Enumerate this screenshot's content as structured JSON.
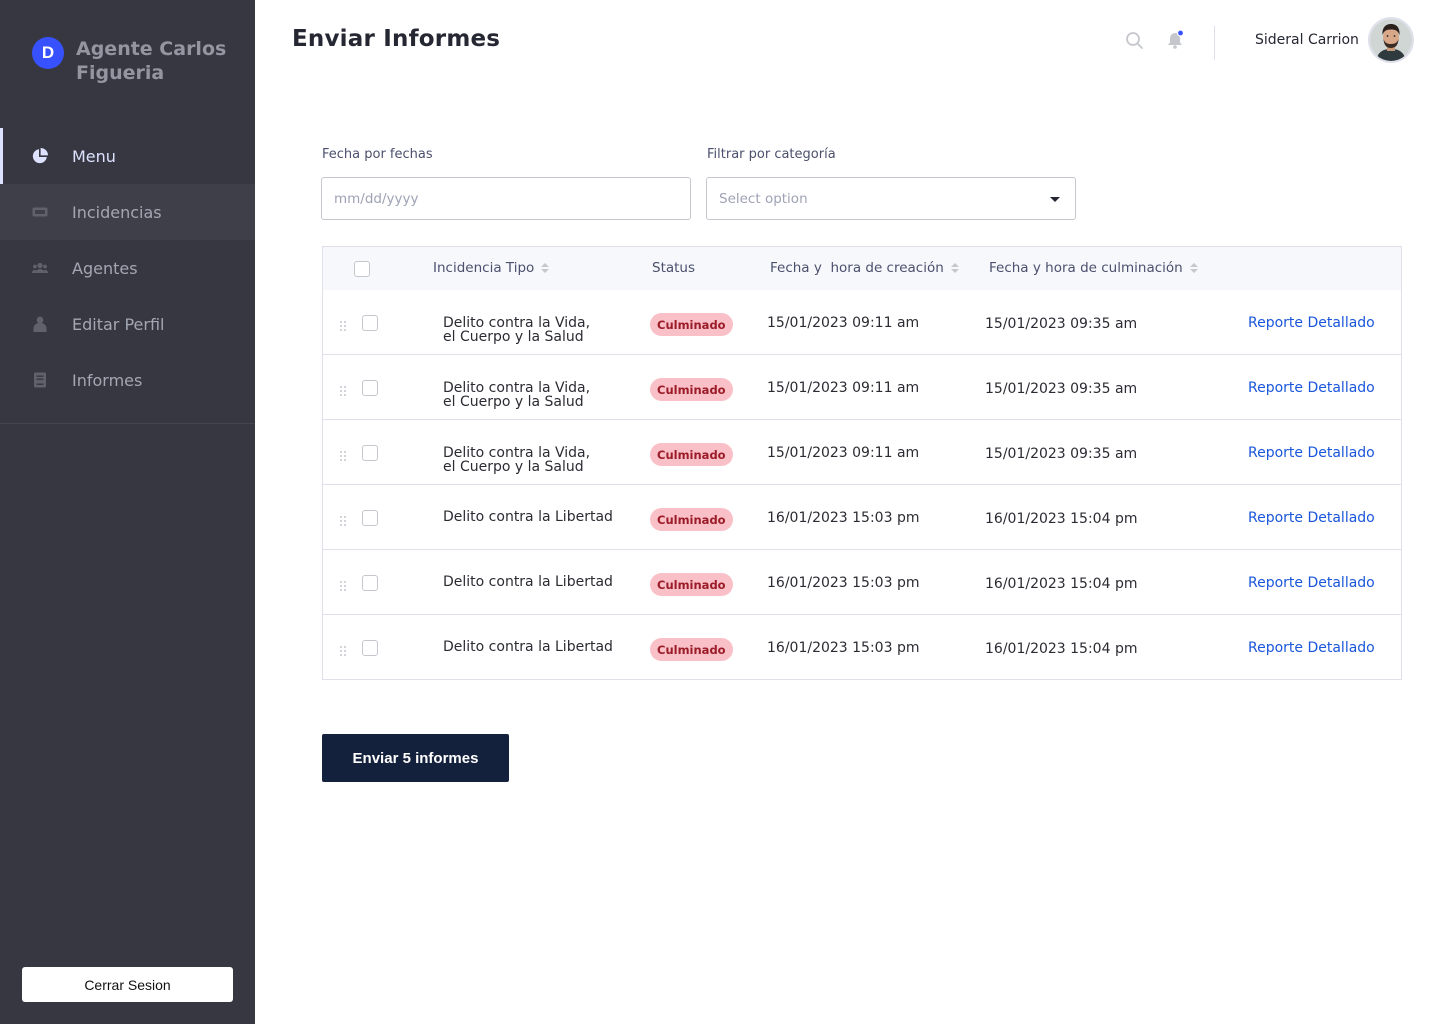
{
  "brand": {
    "logo_letter": "D",
    "name": "Agente Carlos Figueria"
  },
  "sidebar": {
    "items": [
      {
        "label": "Menu",
        "icon": "pie-chart-icon",
        "state": "active"
      },
      {
        "label": "Incidencias",
        "icon": "ticket-icon",
        "state": "hover"
      },
      {
        "label": "Agentes",
        "icon": "users-icon",
        "state": "normal"
      },
      {
        "label": "Editar Perfil",
        "icon": "user-icon",
        "state": "normal"
      },
      {
        "label": "Informes",
        "icon": "book-icon",
        "state": "normal"
      }
    ],
    "logout_label": "Cerrar Sesion"
  },
  "header": {
    "title": "Enviar Informes",
    "user_name": "Sideral Carrion",
    "search_icon": "search-icon",
    "bell_icon": "bell-icon"
  },
  "filters": {
    "date_label": "Fecha por fechas",
    "date_placeholder": "mm/dd/yyyy",
    "category_label": "Filtrar por categoría",
    "category_placeholder": "Select option"
  },
  "table": {
    "columns": {
      "type": "Incidencia Tipo",
      "status": "Status",
      "created": "Fecha y  hora de creación",
      "finished": "Fecha y hora de culminación"
    },
    "rows": [
      {
        "type_line1": "Delito contra la Vida,",
        "type_line2": "el Cuerpo y la Salud",
        "status": "Culminado",
        "created": "15/01/2023 09:11 am",
        "finished": "15/01/2023 09:35 am",
        "action": "Reporte Detallado"
      },
      {
        "type_line1": "Delito contra la Vida,",
        "type_line2": "el Cuerpo y la Salud",
        "status": "Culminado",
        "created": "15/01/2023 09:11 am",
        "finished": "15/01/2023 09:35 am",
        "action": "Reporte Detallado"
      },
      {
        "type_line1": "Delito contra la Vida,",
        "type_line2": "el Cuerpo y la Salud",
        "status": "Culminado",
        "created": "15/01/2023 09:11 am",
        "finished": "15/01/2023 09:35 am",
        "action": "Reporte Detallado"
      },
      {
        "type_line1": "Delito contra la Libertad",
        "type_line2": "",
        "status": "Culminado",
        "created": "16/01/2023 15:03 pm",
        "finished": "16/01/2023 15:04 pm",
        "action": "Reporte Detallado"
      },
      {
        "type_line1": "Delito contra la Libertad",
        "type_line2": "",
        "status": "Culminado",
        "created": "16/01/2023 15:03 pm",
        "finished": "16/01/2023 15:04 pm",
        "action": "Reporte Detallado"
      },
      {
        "type_line1": "Delito contra la Libertad",
        "type_line2": "",
        "status": "Culminado",
        "created": "16/01/2023 15:03 pm",
        "finished": "16/01/2023 15:04 pm",
        "action": "Reporte Detallado"
      }
    ]
  },
  "send_button": {
    "label": "Enviar 5 informes"
  },
  "colors": {
    "sidebar_bg": "#363740",
    "brand_accent": "#3751ff",
    "badge_bg": "#f9c0c7",
    "badge_text": "#9b1c28",
    "link": "#1a56db",
    "primary_button": "#14213d",
    "notification_dot": "#3751ff"
  }
}
